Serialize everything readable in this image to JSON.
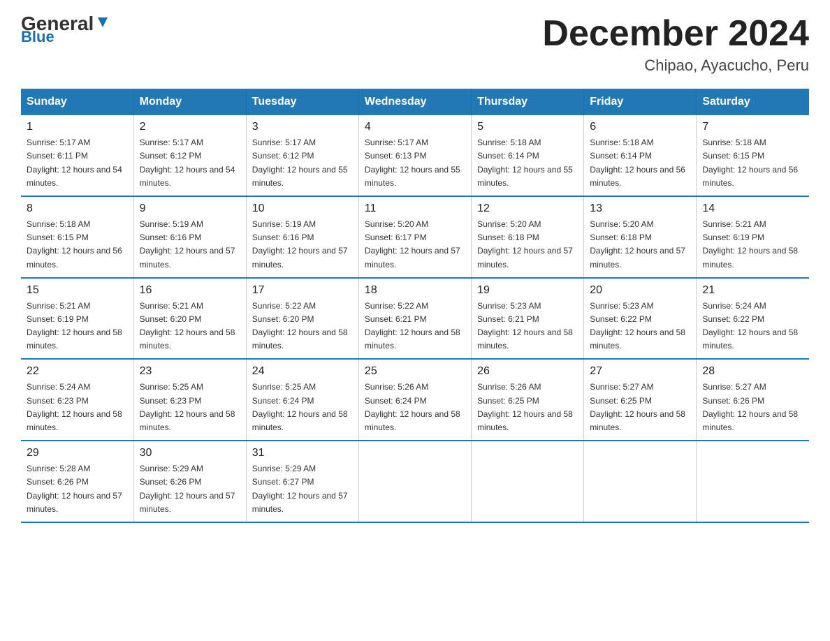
{
  "header": {
    "logo_general": "General",
    "logo_blue": "Blue",
    "month_title": "December 2024",
    "location": "Chipao, Ayacucho, Peru"
  },
  "weekdays": [
    "Sunday",
    "Monday",
    "Tuesday",
    "Wednesday",
    "Thursday",
    "Friday",
    "Saturday"
  ],
  "weeks": [
    [
      {
        "day": "1",
        "sunrise": "5:17 AM",
        "sunset": "6:11 PM",
        "daylight": "12 hours and 54 minutes."
      },
      {
        "day": "2",
        "sunrise": "5:17 AM",
        "sunset": "6:12 PM",
        "daylight": "12 hours and 54 minutes."
      },
      {
        "day": "3",
        "sunrise": "5:17 AM",
        "sunset": "6:12 PM",
        "daylight": "12 hours and 55 minutes."
      },
      {
        "day": "4",
        "sunrise": "5:17 AM",
        "sunset": "6:13 PM",
        "daylight": "12 hours and 55 minutes."
      },
      {
        "day": "5",
        "sunrise": "5:18 AM",
        "sunset": "6:14 PM",
        "daylight": "12 hours and 55 minutes."
      },
      {
        "day": "6",
        "sunrise": "5:18 AM",
        "sunset": "6:14 PM",
        "daylight": "12 hours and 56 minutes."
      },
      {
        "day": "7",
        "sunrise": "5:18 AM",
        "sunset": "6:15 PM",
        "daylight": "12 hours and 56 minutes."
      }
    ],
    [
      {
        "day": "8",
        "sunrise": "5:18 AM",
        "sunset": "6:15 PM",
        "daylight": "12 hours and 56 minutes."
      },
      {
        "day": "9",
        "sunrise": "5:19 AM",
        "sunset": "6:16 PM",
        "daylight": "12 hours and 57 minutes."
      },
      {
        "day": "10",
        "sunrise": "5:19 AM",
        "sunset": "6:16 PM",
        "daylight": "12 hours and 57 minutes."
      },
      {
        "day": "11",
        "sunrise": "5:20 AM",
        "sunset": "6:17 PM",
        "daylight": "12 hours and 57 minutes."
      },
      {
        "day": "12",
        "sunrise": "5:20 AM",
        "sunset": "6:18 PM",
        "daylight": "12 hours and 57 minutes."
      },
      {
        "day": "13",
        "sunrise": "5:20 AM",
        "sunset": "6:18 PM",
        "daylight": "12 hours and 57 minutes."
      },
      {
        "day": "14",
        "sunrise": "5:21 AM",
        "sunset": "6:19 PM",
        "daylight": "12 hours and 58 minutes."
      }
    ],
    [
      {
        "day": "15",
        "sunrise": "5:21 AM",
        "sunset": "6:19 PM",
        "daylight": "12 hours and 58 minutes."
      },
      {
        "day": "16",
        "sunrise": "5:21 AM",
        "sunset": "6:20 PM",
        "daylight": "12 hours and 58 minutes."
      },
      {
        "day": "17",
        "sunrise": "5:22 AM",
        "sunset": "6:20 PM",
        "daylight": "12 hours and 58 minutes."
      },
      {
        "day": "18",
        "sunrise": "5:22 AM",
        "sunset": "6:21 PM",
        "daylight": "12 hours and 58 minutes."
      },
      {
        "day": "19",
        "sunrise": "5:23 AM",
        "sunset": "6:21 PM",
        "daylight": "12 hours and 58 minutes."
      },
      {
        "day": "20",
        "sunrise": "5:23 AM",
        "sunset": "6:22 PM",
        "daylight": "12 hours and 58 minutes."
      },
      {
        "day": "21",
        "sunrise": "5:24 AM",
        "sunset": "6:22 PM",
        "daylight": "12 hours and 58 minutes."
      }
    ],
    [
      {
        "day": "22",
        "sunrise": "5:24 AM",
        "sunset": "6:23 PM",
        "daylight": "12 hours and 58 minutes."
      },
      {
        "day": "23",
        "sunrise": "5:25 AM",
        "sunset": "6:23 PM",
        "daylight": "12 hours and 58 minutes."
      },
      {
        "day": "24",
        "sunrise": "5:25 AM",
        "sunset": "6:24 PM",
        "daylight": "12 hours and 58 minutes."
      },
      {
        "day": "25",
        "sunrise": "5:26 AM",
        "sunset": "6:24 PM",
        "daylight": "12 hours and 58 minutes."
      },
      {
        "day": "26",
        "sunrise": "5:26 AM",
        "sunset": "6:25 PM",
        "daylight": "12 hours and 58 minutes."
      },
      {
        "day": "27",
        "sunrise": "5:27 AM",
        "sunset": "6:25 PM",
        "daylight": "12 hours and 58 minutes."
      },
      {
        "day": "28",
        "sunrise": "5:27 AM",
        "sunset": "6:26 PM",
        "daylight": "12 hours and 58 minutes."
      }
    ],
    [
      {
        "day": "29",
        "sunrise": "5:28 AM",
        "sunset": "6:26 PM",
        "daylight": "12 hours and 57 minutes."
      },
      {
        "day": "30",
        "sunrise": "5:29 AM",
        "sunset": "6:26 PM",
        "daylight": "12 hours and 57 minutes."
      },
      {
        "day": "31",
        "sunrise": "5:29 AM",
        "sunset": "6:27 PM",
        "daylight": "12 hours and 57 minutes."
      },
      null,
      null,
      null,
      null
    ]
  ]
}
